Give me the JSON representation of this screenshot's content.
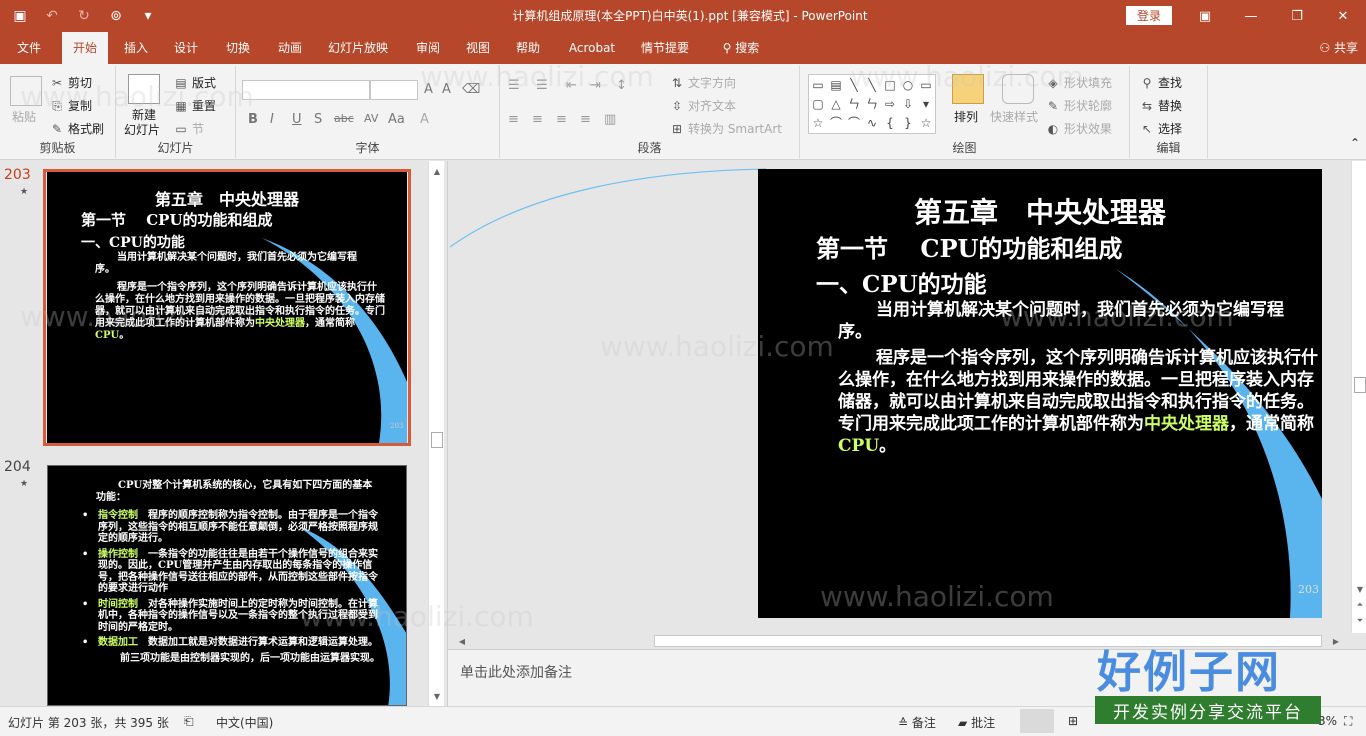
{
  "titlebar": {
    "title": "计算机组成原理(本全PPT)白中英(1).ppt [兼容模式]  -  PowerPoint",
    "login": "登录",
    "controls": {
      "ribbon_display": "▣",
      "minimize": "—",
      "restore": "❐",
      "close": "✕"
    }
  },
  "qat": {
    "save": "▣",
    "undo": "↶",
    "redo": "↻",
    "slideshow": "⊚",
    "more": "▾"
  },
  "menu": {
    "tabs": [
      "文件",
      "开始",
      "插入",
      "设计",
      "切换",
      "动画",
      "幻灯片放映",
      "审阅",
      "视图",
      "帮助",
      "Acrobat",
      "情节提要",
      "搜索"
    ],
    "active": "开始",
    "share": "共享"
  },
  "ribbon": {
    "clipboard": {
      "paste": "粘贴",
      "cut": "剪切",
      "copy": "复制",
      "format_painter": "格式刷",
      "label": "剪贴板"
    },
    "slides": {
      "new_slide": "新建",
      "new_slide2": "幻灯片",
      "layout": "版式",
      "reset": "重置",
      "section": "节",
      "label": "幻灯片"
    },
    "font": {
      "bold": "B",
      "italic": "I",
      "underline": "U",
      "strike": "S",
      "spacing": "abc",
      "spacing2": "AV",
      "case": "Aa",
      "label": "字体"
    },
    "paragraph": {
      "text_direction": "文字方向",
      "align_text": "对齐文本",
      "smartart": "转换为 SmartArt",
      "label": "段落"
    },
    "drawing": {
      "arrange": "排列",
      "quick_styles": "快速样式",
      "fill": "形状填充",
      "outline": "形状轮廓",
      "effects": "形状效果",
      "label": "绘图"
    },
    "editing": {
      "find": "查找",
      "replace": "替换",
      "select": "选择",
      "label": "编辑"
    }
  },
  "thumbnails": {
    "items": [
      {
        "number": "203",
        "chapter": "第五章　中央处理器",
        "section": "第一节　 CPU的功能和组成",
        "subtitle": "一、CPU的功能",
        "p1": "当用计算机解决某个问题时，我们首先必须为它编写程序。",
        "p2_pre": "程序是一个指令序列，这个序列明确告诉计算机应该执行什么操作，在什么地方找到用来操作的数据。一旦把程序装入内存储器，就可以由计算机来自动完成取出指令和执行指令的任务。专门用来完成此项工作的计算机部件称为",
        "p2_hl1": "中央处理器",
        "p2_mid": "，通常简称",
        "p2_hl2": "CPU",
        "p2_end": "。",
        "page": "203"
      },
      {
        "number": "204",
        "intro": "CPU对整个计算机系统的核心，它具有如下四方面的基本功能：",
        "bullets": [
          {
            "term": "指令控制",
            "text": "　程序的顺序控制称为指令控制。由于程序是一个指令序列，这些指令的相互顺序不能任意颠倒，必须严格按照程序规定的顺序进行。"
          },
          {
            "term": "操作控制",
            "text": "　一条指令的功能往往是由若干个操作信号的组合来实现的。因此，CPU管理并产生由内存取出的每条指令的操作信号，把各种操作信号送往相应的部件，从而控制这些部件按指令的要求进行动作"
          },
          {
            "term": "时间控制",
            "text": "　对各种操作实施时间上的定时称为时间控制。在计算机中，各种指令的操作信号以及一条指令的整个执行过程都受到时间的严格定时。"
          },
          {
            "term": "数据加工",
            "text": "　数据加工就是对数据进行算术运算和逻辑运算处理。"
          }
        ],
        "outro": "前三项功能是由控制器实现的，后一项功能由运算器实现。"
      }
    ]
  },
  "slide": {
    "chapter": "第五章　中央处理器",
    "section": "第一节　 CPU的功能和组成",
    "subtitle": "一、CPU的功能",
    "p1": "当用计算机解决某个问题时，我们首先必须为它编写程序。",
    "p2_pre": "程序是一个指令序列，这个序列明确告诉计算机应该执行什么操作，在什么地方找到用来操作的数据。一旦把程序装入内存储器，就可以由计算机来自动完成取出指令和执行指令的任务。专门用来完成此项工作的计算机部件称为",
    "p2_hl1": "中央处理器",
    "p2_mid": "，通常简称",
    "p2_hl2": "CPU",
    "p2_end": "。",
    "page": "203"
  },
  "notes_placeholder": "单击此处添加备注",
  "statusbar": {
    "slide_info": "幻灯片 第 203 张，共 395 张",
    "language": "中文(中国)",
    "notes": "备注",
    "comments": "批注",
    "zoom": "3%"
  },
  "watermark": {
    "site": "www.haolizi.com",
    "logo": "好例子网",
    "tagline": "开发实例分享交流平台"
  },
  "colors": {
    "accent": "#b7472a",
    "highlight": "#ccff66",
    "selected_border": "#d65b3a"
  }
}
